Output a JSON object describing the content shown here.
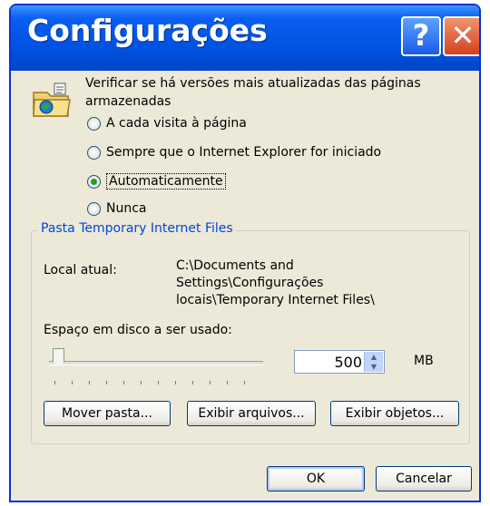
{
  "window": {
    "title": "Configurações",
    "help_glyph": "?",
    "close_glyph": "✕"
  },
  "check": {
    "question": "Verificar se há versões mais atualizadas das páginas armazenadas",
    "options": [
      {
        "label": "A cada visita à página",
        "selected": false
      },
      {
        "label": "Sempre que o Internet Explorer for iniciado",
        "selected": false
      },
      {
        "label": "Automaticamente",
        "selected": true
      },
      {
        "label": "Nunca",
        "selected": false
      }
    ]
  },
  "folder": {
    "group_title": "Pasta Temporary Internet Files",
    "location_label": "Local atual:",
    "location_value_lines": [
      "C:\\Documents and",
      "Settings\\Configurações",
      "locais\\Temporary Internet Files\\"
    ],
    "disk_label": "Espaço em disco a ser usado:",
    "disk_value": "500",
    "disk_unit": "MB",
    "slider_level_fraction": 0.03,
    "buttons": {
      "move": "Mover pasta...",
      "view_files": "Exibir arquivos...",
      "view_objects": "Exibir objetos..."
    }
  },
  "footer": {
    "ok": "OK",
    "cancel": "Cancelar"
  },
  "colors": {
    "titlebar": "#0054e3",
    "dialog_bg": "#ece9d8",
    "group_title": "#0046d5",
    "radio_dot": "#21a121",
    "close_button": "#d3411c"
  },
  "icons": [
    "help-icon",
    "close-icon",
    "folder-globe-icon",
    "spin-up-icon",
    "spin-down-icon"
  ]
}
